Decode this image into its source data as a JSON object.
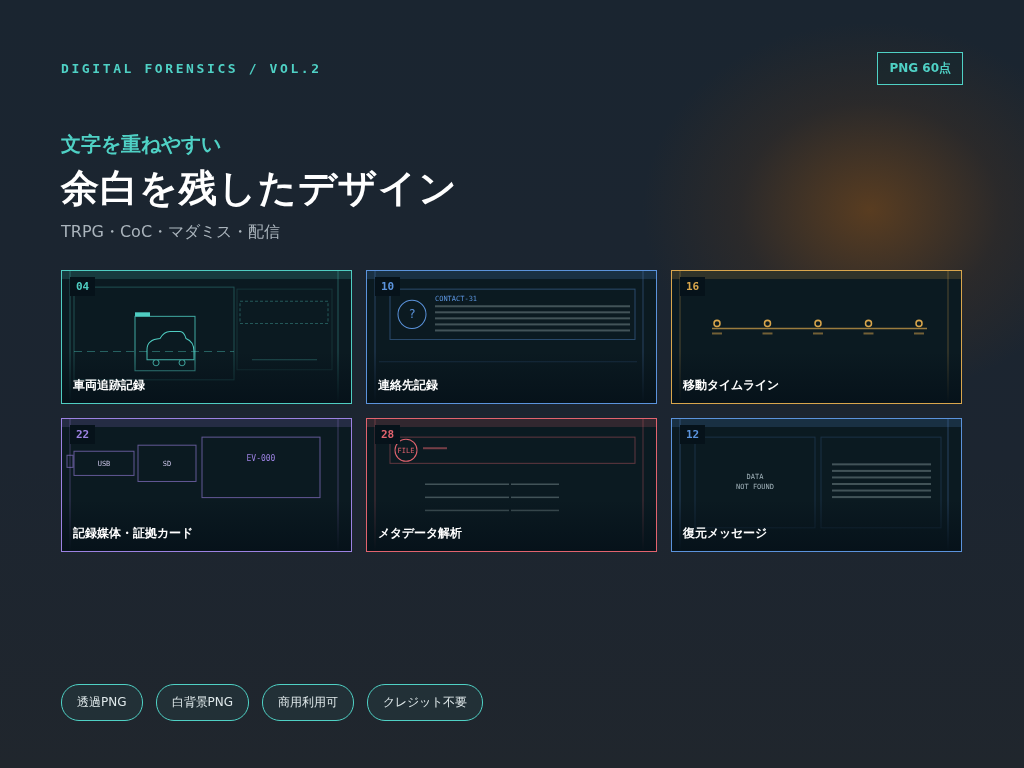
{
  "header": {
    "series": "DIGITAL FORENSICS / VOL.2",
    "badge": "PNG 60点"
  },
  "hero": {
    "lead": "文字を重ねやすい",
    "title": "余白を残したデザイン",
    "tagline": "TRPG・CoC・マダミス・配信"
  },
  "cards": [
    {
      "number": "04",
      "title": "車両追跡記録",
      "color": "#4fcdc2",
      "kind": "vehicle"
    },
    {
      "number": "10",
      "title": "連絡先記録",
      "color": "#5b93dc",
      "kind": "contact",
      "mark": "?",
      "id": "CONTACT-31"
    },
    {
      "number": "16",
      "title": "移動タイムライン",
      "color": "#d9a64c",
      "kind": "timeline"
    },
    {
      "number": "22",
      "title": "記録媒体・証拠カード",
      "color": "#9c82e2",
      "kind": "media",
      "labels": [
        "USB",
        "SD"
      ],
      "id": "EV-000"
    },
    {
      "number": "28",
      "title": "メタデータ解析",
      "color": "#e2636e",
      "kind": "metadata",
      "mark": "FILE"
    },
    {
      "number": "12",
      "title": "復元メッセージ",
      "color": "#5b93dc",
      "kind": "recovery",
      "message": [
        "DATA",
        "NOT FOUND"
      ]
    }
  ],
  "tags": [
    "透過PNG",
    "白背景PNG",
    "商用利用可",
    "クレジット不要"
  ]
}
